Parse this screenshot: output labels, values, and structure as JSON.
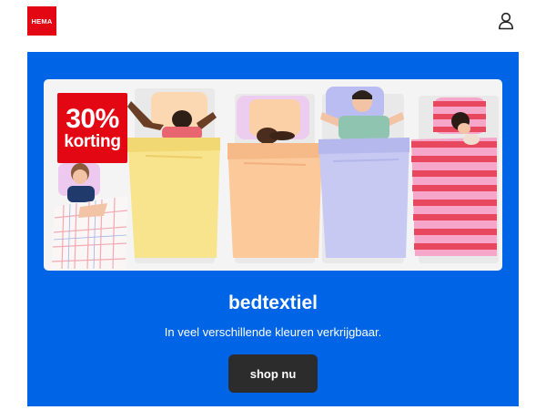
{
  "header": {
    "logo_text": "HEMA",
    "account_icon": "user-icon"
  },
  "promo": {
    "badge": {
      "percent": "30%",
      "text": "korting"
    },
    "title": "bedtextiel",
    "subtitle": "In veel verschillende kleuren verkrijgbaar.",
    "cta_label": "shop nu"
  },
  "colors": {
    "brand_red": "#e30613",
    "promo_blue": "#0064e6",
    "button_dark": "#2c2c2c",
    "duvet_yellow": "#f7e48c",
    "duvet_peach": "#fbc99a",
    "duvet_lilac": "#c7c9f2",
    "duvet_stripe_red": "#e8485e",
    "duvet_stripe_pink": "#f5a6c9"
  }
}
